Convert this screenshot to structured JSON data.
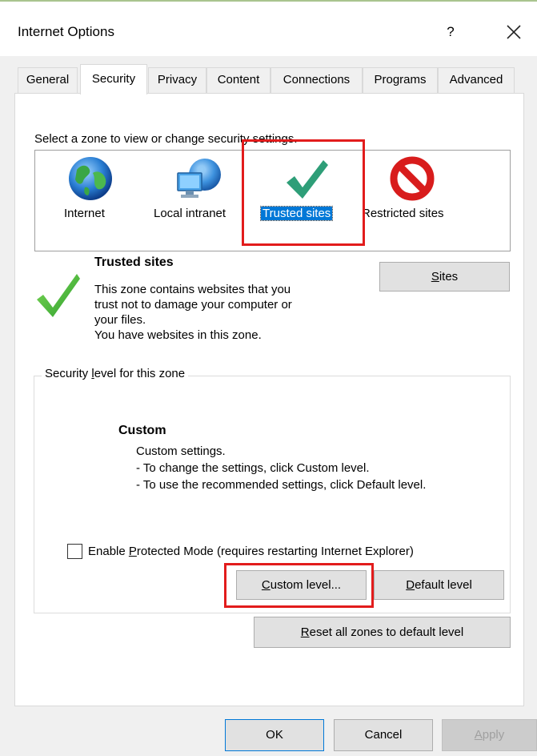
{
  "window": {
    "title": "Internet Options",
    "help_label": "?",
    "close_icon": "close-icon"
  },
  "tabs": [
    {
      "label": "General"
    },
    {
      "label": "Security",
      "active": true
    },
    {
      "label": "Privacy"
    },
    {
      "label": "Content"
    },
    {
      "label": "Connections"
    },
    {
      "label": "Programs"
    },
    {
      "label": "Advanced"
    }
  ],
  "zones": {
    "instruction": "Select a zone to view or change security settings.",
    "items": [
      {
        "label": "Internet",
        "icon": "globe-icon"
      },
      {
        "label": "Local intranet",
        "icon": "network-globe-icon"
      },
      {
        "label": "Trusted sites",
        "icon": "checkmark-icon",
        "selected": true
      },
      {
        "label": "Restricted sites",
        "icon": "prohibited-icon"
      }
    ]
  },
  "zone_info": {
    "title": "Trusted sites",
    "description_lines": [
      "This zone contains websites that you",
      "trust not to damage your computer or",
      "your files.",
      "You have websites in this zone."
    ],
    "sites_button": {
      "prefix": "",
      "mnemonic": "S",
      "rest": "ites"
    }
  },
  "security_level": {
    "group_label": {
      "prefix": "Security ",
      "mnemonic": "l",
      "rest": "evel for this zone"
    },
    "level_name": "Custom",
    "level_lines": [
      "Custom settings.",
      "- To change the settings, click Custom level.",
      "- To use the recommended settings, click Default level."
    ],
    "protected_mode": {
      "prefix": "Enable ",
      "mnemonic": "P",
      "rest": "rotected Mode (requires restarting Internet Explorer)",
      "checked": false
    },
    "custom_level_button": {
      "prefix": "",
      "mnemonic": "C",
      "rest": "ustom level..."
    },
    "default_level_button": {
      "prefix": "",
      "mnemonic": "D",
      "rest": "efault level"
    },
    "reset_button": {
      "prefix": "",
      "mnemonic": "R",
      "rest": "eset all zones to default level"
    }
  },
  "footer": {
    "ok": "OK",
    "cancel": "Cancel",
    "apply": {
      "prefix": "",
      "mnemonic": "A",
      "rest": "pply"
    }
  },
  "colors": {
    "highlight": "#e21c1c",
    "selection": "#0078d7",
    "check_green": "#2e9e78"
  }
}
